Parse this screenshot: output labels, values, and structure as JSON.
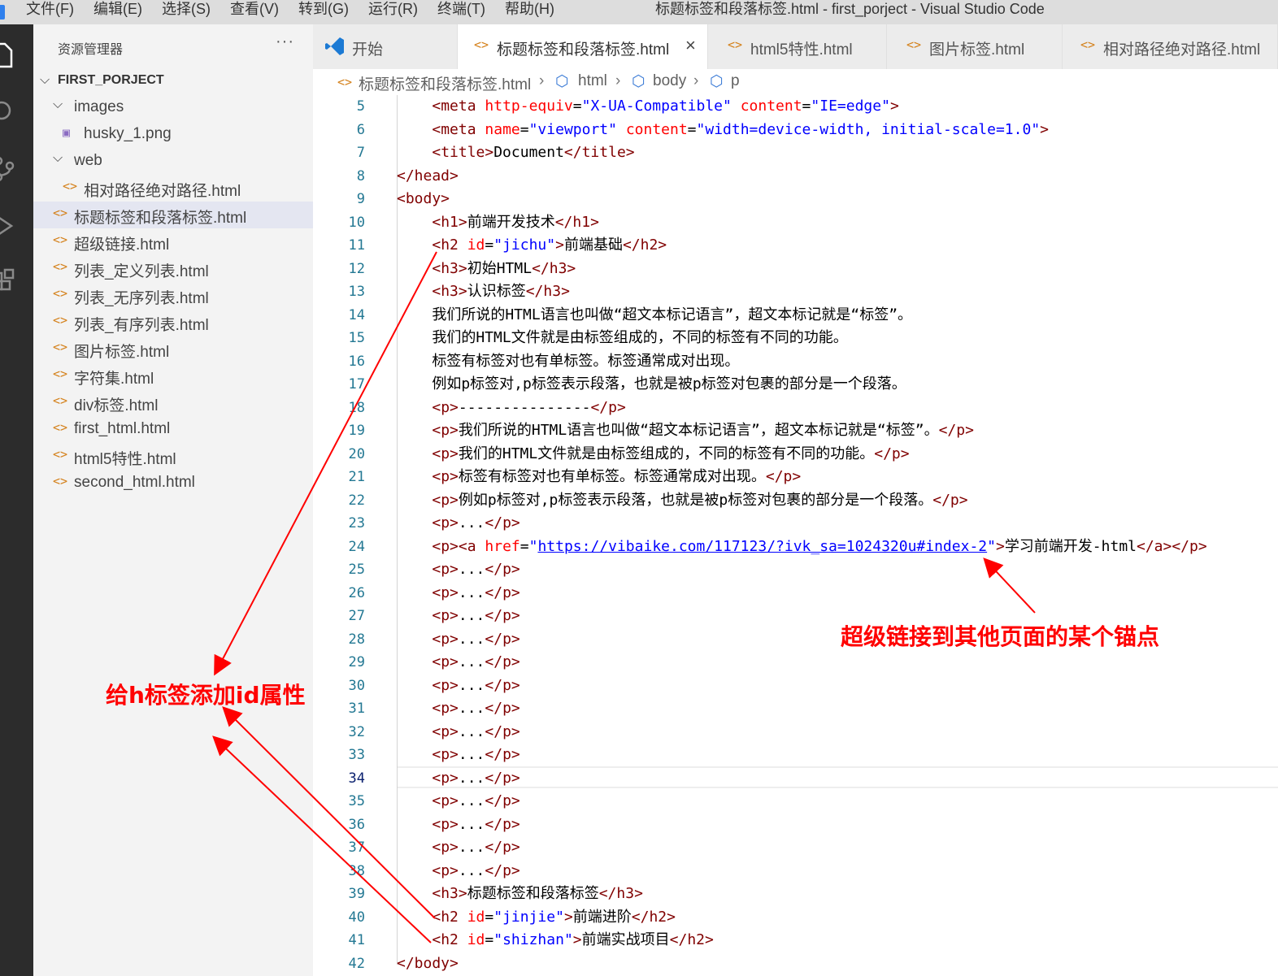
{
  "titlebar": {
    "menus": [
      "文件(F)",
      "编辑(E)",
      "选择(S)",
      "查看(V)",
      "转到(G)",
      "运行(R)",
      "终端(T)",
      "帮助(H)"
    ],
    "window_title": "标题标签和段落标签.html - first_porject - Visual Studio Code"
  },
  "activity_bar": [
    "explorer-icon",
    "search-icon",
    "source-control-icon",
    "run-debug-icon",
    "extensions-icon"
  ],
  "sidebar": {
    "title": "资源管理器",
    "more": "···",
    "project": "FIRST_PORJECT",
    "tree": [
      {
        "label": "images",
        "type": "folder",
        "expanded": true
      },
      {
        "label": "husky_1.png",
        "type": "image"
      },
      {
        "label": "web",
        "type": "folder",
        "expanded": true
      },
      {
        "label": "相对路径绝对路径.html",
        "type": "html"
      },
      {
        "label": "标题标签和段落标签.html",
        "type": "html",
        "selected": true
      },
      {
        "label": "超级链接.html",
        "type": "html"
      },
      {
        "label": "列表_定义列表.html",
        "type": "html"
      },
      {
        "label": "列表_无序列表.html",
        "type": "html"
      },
      {
        "label": "列表_有序列表.html",
        "type": "html"
      },
      {
        "label": "图片标签.html",
        "type": "html"
      },
      {
        "label": "字符集.html",
        "type": "html"
      },
      {
        "label": "div标签.html",
        "type": "html"
      },
      {
        "label": "first_html.html",
        "type": "html"
      },
      {
        "label": "html5特性.html",
        "type": "html"
      },
      {
        "label": "second_html.html",
        "type": "html"
      }
    ]
  },
  "tabs": [
    {
      "label": "开始",
      "icon": "vscode-icon",
      "active": false
    },
    {
      "label": "标题标签和段落标签.html",
      "icon": "html-file-icon",
      "active": true,
      "close": "×"
    },
    {
      "label": "html5特性.html",
      "icon": "html-file-icon",
      "active": false
    },
    {
      "label": "图片标签.html",
      "icon": "html-file-icon",
      "active": false
    },
    {
      "label": "相对路径绝对路径.html",
      "icon": "html-file-icon",
      "active": false
    }
  ],
  "breadcrumb": [
    "标题标签和段落标签.html",
    "html",
    "body",
    "p"
  ],
  "editor": {
    "current_line": 34,
    "lines": [
      {
        "n": 5,
        "tokens": [
          [
            "text",
            "    "
          ],
          [
            "tag",
            "<meta "
          ],
          [
            "attr",
            "http-equiv"
          ],
          [
            "text",
            "="
          ],
          [
            "str",
            "\"X-UA-Compatible\""
          ],
          [
            "text",
            " "
          ],
          [
            "attr",
            "content"
          ],
          [
            "text",
            "="
          ],
          [
            "str",
            "\"IE=edge\""
          ],
          [
            "tag",
            ">"
          ]
        ]
      },
      {
        "n": 6,
        "tokens": [
          [
            "text",
            "    "
          ],
          [
            "tag",
            "<meta "
          ],
          [
            "attr",
            "name"
          ],
          [
            "text",
            "="
          ],
          [
            "str",
            "\"viewport\""
          ],
          [
            "text",
            " "
          ],
          [
            "attr",
            "content"
          ],
          [
            "text",
            "="
          ],
          [
            "str",
            "\"width=device-width, initial-scale=1.0\""
          ],
          [
            "tag",
            ">"
          ]
        ]
      },
      {
        "n": 7,
        "tokens": [
          [
            "text",
            "    "
          ],
          [
            "tag",
            "<title>"
          ],
          [
            "text",
            "Document"
          ],
          [
            "tag",
            "</title>"
          ]
        ]
      },
      {
        "n": 8,
        "tokens": [
          [
            "tag",
            "</head>"
          ]
        ]
      },
      {
        "n": 9,
        "tokens": [
          [
            "tag",
            "<body>"
          ]
        ]
      },
      {
        "n": 10,
        "tokens": [
          [
            "text",
            "    "
          ],
          [
            "tag",
            "<h1>"
          ],
          [
            "text",
            "前端开发技术"
          ],
          [
            "tag",
            "</h1>"
          ]
        ]
      },
      {
        "n": 11,
        "tokens": [
          [
            "text",
            "    "
          ],
          [
            "tag",
            "<h2 "
          ],
          [
            "attr",
            "id"
          ],
          [
            "text",
            "="
          ],
          [
            "str",
            "\"jichu\""
          ],
          [
            "tag",
            ">"
          ],
          [
            "text",
            "前端基础"
          ],
          [
            "tag",
            "</h2>"
          ]
        ]
      },
      {
        "n": 12,
        "tokens": [
          [
            "text",
            "    "
          ],
          [
            "tag",
            "<h3>"
          ],
          [
            "text",
            "初始HTML"
          ],
          [
            "tag",
            "</h3>"
          ]
        ]
      },
      {
        "n": 13,
        "tokens": [
          [
            "text",
            "    "
          ],
          [
            "tag",
            "<h3>"
          ],
          [
            "text",
            "认识标签"
          ],
          [
            "tag",
            "</h3>"
          ]
        ]
      },
      {
        "n": 14,
        "tokens": [
          [
            "text",
            "    我们所说的HTML语言也叫做“超文本标记语言”，超文本标记就是“标签”。"
          ]
        ]
      },
      {
        "n": 15,
        "tokens": [
          [
            "text",
            "    我们的HTML文件就是由标签组成的，不同的标签有不同的功能。"
          ]
        ]
      },
      {
        "n": 16,
        "tokens": [
          [
            "text",
            "    标签有标签对也有单标签。标签通常成对出现。"
          ]
        ]
      },
      {
        "n": 17,
        "tokens": [
          [
            "text",
            "    例如p标签对,p标签表示段落，也就是被p标签对包裹的部分是一个段落。"
          ]
        ]
      },
      {
        "n": 18,
        "tokens": [
          [
            "text",
            "    "
          ],
          [
            "tag",
            "<p>"
          ],
          [
            "text",
            "---------------"
          ],
          [
            "tag",
            "</p>"
          ]
        ]
      },
      {
        "n": 19,
        "tokens": [
          [
            "text",
            "    "
          ],
          [
            "tag",
            "<p>"
          ],
          [
            "text",
            "我们所说的HTML语言也叫做“超文本标记语言”，超文本标记就是“标签”。"
          ],
          [
            "tag",
            "</p>"
          ]
        ]
      },
      {
        "n": 20,
        "tokens": [
          [
            "text",
            "    "
          ],
          [
            "tag",
            "<p>"
          ],
          [
            "text",
            "我们的HTML文件就是由标签组成的，不同的标签有不同的功能。"
          ],
          [
            "tag",
            "</p>"
          ]
        ]
      },
      {
        "n": 21,
        "tokens": [
          [
            "text",
            "    "
          ],
          [
            "tag",
            "<p>"
          ],
          [
            "text",
            "标签有标签对也有单标签。标签通常成对出现。"
          ],
          [
            "tag",
            "</p>"
          ]
        ]
      },
      {
        "n": 22,
        "tokens": [
          [
            "text",
            "    "
          ],
          [
            "tag",
            "<p>"
          ],
          [
            "text",
            "例如p标签对,p标签表示段落，也就是被p标签对包裹的部分是一个段落。"
          ],
          [
            "tag",
            "</p>"
          ]
        ]
      },
      {
        "n": 23,
        "tokens": [
          [
            "text",
            "    "
          ],
          [
            "tag",
            "<p>"
          ],
          [
            "text",
            "..."
          ],
          [
            "tag",
            "</p>"
          ]
        ]
      },
      {
        "n": 24,
        "tokens": [
          [
            "text",
            "    "
          ],
          [
            "tag",
            "<p><a "
          ],
          [
            "attr",
            "href"
          ],
          [
            "text",
            "="
          ],
          [
            "str",
            "\""
          ],
          [
            "link",
            "https://vibaike.com/117123/?ivk_sa=1024320u#index-2"
          ],
          [
            "str",
            "\""
          ],
          [
            "tag",
            ">"
          ],
          [
            "text",
            "学习前端开发-html"
          ],
          [
            "tag",
            "</a></p>"
          ]
        ]
      },
      {
        "n": 25,
        "tokens": [
          [
            "text",
            "    "
          ],
          [
            "tag",
            "<p>"
          ],
          [
            "text",
            "..."
          ],
          [
            "tag",
            "</p>"
          ]
        ]
      },
      {
        "n": 26,
        "tokens": [
          [
            "text",
            "    "
          ],
          [
            "tag",
            "<p>"
          ],
          [
            "text",
            "..."
          ],
          [
            "tag",
            "</p>"
          ]
        ]
      },
      {
        "n": 27,
        "tokens": [
          [
            "text",
            "    "
          ],
          [
            "tag",
            "<p>"
          ],
          [
            "text",
            "..."
          ],
          [
            "tag",
            "</p>"
          ]
        ]
      },
      {
        "n": 28,
        "tokens": [
          [
            "text",
            "    "
          ],
          [
            "tag",
            "<p>"
          ],
          [
            "text",
            "..."
          ],
          [
            "tag",
            "</p>"
          ]
        ]
      },
      {
        "n": 29,
        "tokens": [
          [
            "text",
            "    "
          ],
          [
            "tag",
            "<p>"
          ],
          [
            "text",
            "..."
          ],
          [
            "tag",
            "</p>"
          ]
        ]
      },
      {
        "n": 30,
        "tokens": [
          [
            "text",
            "    "
          ],
          [
            "tag",
            "<p>"
          ],
          [
            "text",
            "..."
          ],
          [
            "tag",
            "</p>"
          ]
        ]
      },
      {
        "n": 31,
        "tokens": [
          [
            "text",
            "    "
          ],
          [
            "tag",
            "<p>"
          ],
          [
            "text",
            "..."
          ],
          [
            "tag",
            "</p>"
          ]
        ]
      },
      {
        "n": 32,
        "tokens": [
          [
            "text",
            "    "
          ],
          [
            "tag",
            "<p>"
          ],
          [
            "text",
            "..."
          ],
          [
            "tag",
            "</p>"
          ]
        ]
      },
      {
        "n": 33,
        "tokens": [
          [
            "text",
            "    "
          ],
          [
            "tag",
            "<p>"
          ],
          [
            "text",
            "..."
          ],
          [
            "tag",
            "</p>"
          ]
        ]
      },
      {
        "n": 34,
        "tokens": [
          [
            "text",
            "    "
          ],
          [
            "tag",
            "<p>"
          ],
          [
            "text",
            "..."
          ],
          [
            "tag",
            "</p>"
          ]
        ]
      },
      {
        "n": 35,
        "tokens": [
          [
            "text",
            "    "
          ],
          [
            "tag",
            "<p>"
          ],
          [
            "text",
            "..."
          ],
          [
            "tag",
            "</p>"
          ]
        ]
      },
      {
        "n": 36,
        "tokens": [
          [
            "text",
            "    "
          ],
          [
            "tag",
            "<p>"
          ],
          [
            "text",
            "..."
          ],
          [
            "tag",
            "</p>"
          ]
        ]
      },
      {
        "n": 37,
        "tokens": [
          [
            "text",
            "    "
          ],
          [
            "tag",
            "<p>"
          ],
          [
            "text",
            "..."
          ],
          [
            "tag",
            "</p>"
          ]
        ]
      },
      {
        "n": 38,
        "tokens": [
          [
            "text",
            "    "
          ],
          [
            "tag",
            "<p>"
          ],
          [
            "text",
            "..."
          ],
          [
            "tag",
            "</p>"
          ]
        ]
      },
      {
        "n": 39,
        "tokens": [
          [
            "text",
            "    "
          ],
          [
            "tag",
            "<h3>"
          ],
          [
            "text",
            "标题标签和段落标签"
          ],
          [
            "tag",
            "</h3>"
          ]
        ]
      },
      {
        "n": 40,
        "tokens": [
          [
            "text",
            "    "
          ],
          [
            "tag",
            "<h2 "
          ],
          [
            "attr",
            "id"
          ],
          [
            "text",
            "="
          ],
          [
            "str",
            "\"jinjie\""
          ],
          [
            "tag",
            ">"
          ],
          [
            "text",
            "前端进阶"
          ],
          [
            "tag",
            "</h2>"
          ]
        ]
      },
      {
        "n": 41,
        "tokens": [
          [
            "text",
            "    "
          ],
          [
            "tag",
            "<h2 "
          ],
          [
            "attr",
            "id"
          ],
          [
            "text",
            "="
          ],
          [
            "str",
            "\"shizhan\""
          ],
          [
            "tag",
            ">"
          ],
          [
            "text",
            "前端实战项目"
          ],
          [
            "tag",
            "</h2>"
          ]
        ]
      },
      {
        "n": 42,
        "tokens": [
          [
            "tag",
            "</body>"
          ]
        ]
      }
    ]
  },
  "annotations": {
    "h_id_note": "给h标签添加id属性",
    "anchor_link_note": "超级链接到其他页面的某个锚点",
    "color": "#ff0000"
  }
}
